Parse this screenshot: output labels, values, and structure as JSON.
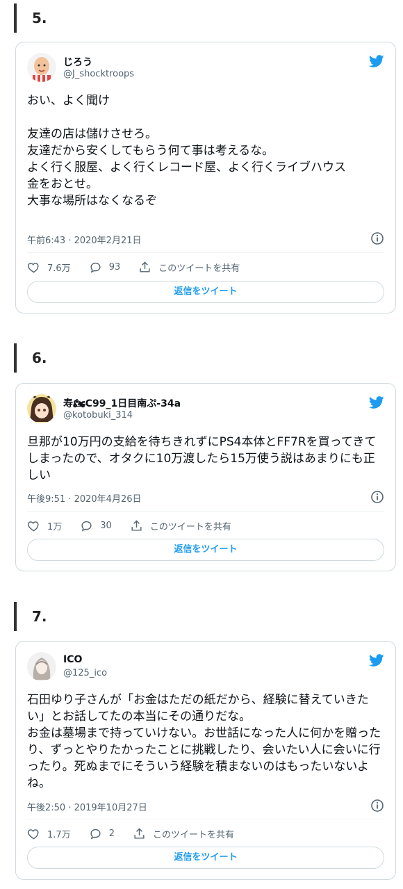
{
  "sections": [
    {
      "number": "5.",
      "name": "じろう",
      "handle": "@J_shocktroops",
      "text": "おい、よく聞け\n\n友達の店は儲けさせろ。\n友達だから安くしてもらう何て事は考えるな。\nよく行く服屋、よく行くレコード屋、よく行くライブハウス\n金をおとせ。\n大事な場所はなくなるぞ",
      "timestamp": "午前6:43 · 2020年2月21日",
      "likes": "7.6万",
      "replies": "93",
      "share_label": "このツイートを共有",
      "reply_label": "返信をツイート"
    },
    {
      "number": "6.",
      "name": "寿🏍C99_1日目南ぷ-34a",
      "handle": "@kotobuki_314",
      "text": "旦那が10万円の支給を待ちきれずにPS4本体とFF7Rを買ってきてしまったので、オタクに10万渡したら15万使う説はあまりにも正しい",
      "timestamp": "午後9:51 · 2020年4月26日",
      "likes": "1万",
      "replies": "30",
      "share_label": "このツイートを共有",
      "reply_label": "返信をツイート"
    },
    {
      "number": "7.",
      "name": "ICO",
      "handle": "@125_ico",
      "text": "石田ゆり子さんが「お金はただの紙だから、経験に替えていきたい」とお話してたの本当にその通りだな。\nお金は墓場まで持っていけない。お世話になった人に何かを贈ったり、ずっとやりたかったことに挑戦したり、会いたい人に会いに行ったり。死ぬまでにそういう経験を積まないのはもったいないよね。",
      "timestamp": "午後2:50 · 2019年10月27日",
      "likes": "1.7万",
      "replies": "2",
      "share_label": "このツイートを共有",
      "reply_label": "返信をツイート"
    }
  ],
  "colors": {
    "twitter_blue": "#1d9bf0",
    "border": "#cfd9de",
    "muted": "#536471"
  },
  "icons": [
    "twitter-bird-icon",
    "info-icon",
    "heart-icon",
    "reply-icon",
    "share-icon"
  ]
}
